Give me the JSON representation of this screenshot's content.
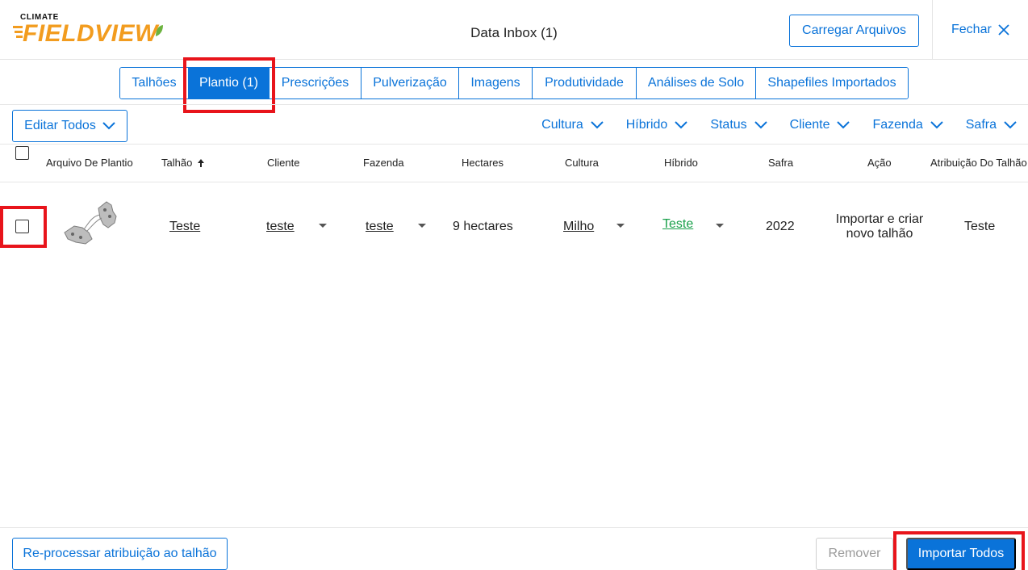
{
  "header": {
    "brand_small": "CLIMATE",
    "brand_large": "FIELDVIEW",
    "title": "Data Inbox (1)",
    "upload_label": "Carregar Arquivos",
    "close_label": "Fechar"
  },
  "tabs": [
    {
      "label": "Talhões",
      "active": false
    },
    {
      "label": "Plantio (1)",
      "active": true
    },
    {
      "label": "Prescrições",
      "active": false
    },
    {
      "label": "Pulverização",
      "active": false
    },
    {
      "label": "Imagens",
      "active": false
    },
    {
      "label": "Produtividade",
      "active": false
    },
    {
      "label": "Análises de Solo",
      "active": false
    },
    {
      "label": "Shapefiles Importados",
      "active": false
    }
  ],
  "toolbar": {
    "edit_all_label": "Editar Todos",
    "filters": [
      "Cultura",
      "Híbrido",
      "Status",
      "Cliente",
      "Fazenda",
      "Safra"
    ]
  },
  "table": {
    "columns": [
      "Arquivo De Plantio",
      "Talhão",
      "Cliente",
      "Fazenda",
      "Hectares",
      "Cultura",
      "Híbrido",
      "Safra",
      "Ação",
      "Atribuição Do Talhão"
    ],
    "rows": [
      {
        "talhao": "Teste",
        "cliente": "teste",
        "fazenda": "teste",
        "hectares": "9 hectares",
        "cultura": "Milho",
        "hibrido": "Teste",
        "safra": "2022",
        "acao_line1": "Importar e criar",
        "acao_line2": "novo talhão",
        "atribuicao": "Teste"
      }
    ]
  },
  "footer": {
    "reprocess_label": "Re-processar atribuição ao talhão",
    "remove_label": "Remover",
    "import_all_label": "Importar Todos"
  },
  "colors": {
    "accent": "#0a73d9",
    "brand_orange": "#f29c1f",
    "highlight": "#e8141b",
    "link_green": "#19a04a"
  }
}
